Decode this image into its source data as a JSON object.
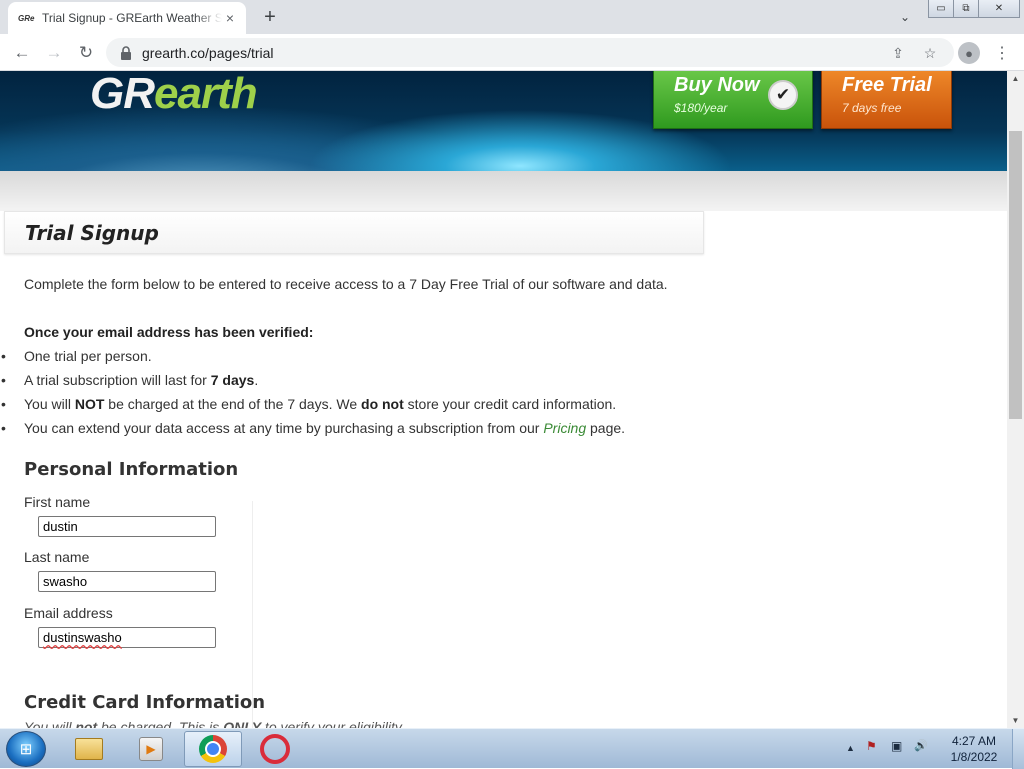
{
  "browser": {
    "tab": {
      "favicon": "GRe",
      "title": "Trial Signup - GREarth Weather S",
      "close": "×"
    },
    "new_tab": "+",
    "tab_search": "⌄",
    "window_controls": {
      "minimize": "▭",
      "restore": "⧉",
      "close": "✕"
    },
    "nav": {
      "back": "←",
      "forward": "→",
      "reload": "↻"
    },
    "url": "grearth.co/pages/trial",
    "icons": {
      "lock": "lock-icon",
      "share": "share-icon",
      "bookmark": "star-icon",
      "profile": "profile-icon",
      "menu": "kebab-menu-icon"
    }
  },
  "banner": {
    "logo": {
      "part1": "GR",
      "part2": "earth"
    },
    "buy": {
      "title": "Buy Now",
      "price": "$180/year",
      "check": "✔"
    },
    "trial": {
      "title": "Free Trial",
      "subtitle": "7 days free"
    }
  },
  "page": {
    "heading": "Trial Signup",
    "intro": "Complete the form below to be entered to receive access to a 7 Day Free Trial of our software and data.",
    "verify_heading": "Once your email address has been verified:",
    "bullets": {
      "b1": "One trial per person.",
      "b2_pre": "A trial subscription will last for ",
      "b2_bold": "7 days",
      "b2_post": ".",
      "b3_pre": "You will ",
      "b3_not": "NOT",
      "b3_mid": " be charged at the end of the 7 days. We ",
      "b3_donot": "do not",
      "b3_post": " store your credit card information.",
      "b4_pre": "You can extend your data access at any time by purchasing a subscription from our ",
      "b4_link": "Pricing",
      "b4_post": " page."
    },
    "personal": {
      "title": "Personal Information",
      "first_name_label": "First name",
      "first_name_value": "dustin",
      "last_name_label": "Last name",
      "last_name_value": "swasho",
      "email_label": "Email address",
      "email_value": "dustinswasho"
    },
    "credit": {
      "title": "Credit Card Information",
      "note_pre": "You will ",
      "note_not": "not",
      "note_mid": " be charged. This is ",
      "note_only": "ONLY",
      "note_post": " to verify your eligibility."
    }
  },
  "taskbar": {
    "start": "⊞",
    "apps": [
      "file-explorer-icon",
      "media-player-icon",
      "chrome-icon",
      "opera-icon"
    ],
    "tray": {
      "arrow": "▲",
      "flag": "⚑",
      "network": "▣",
      "volume": "🔊"
    },
    "time": "4:27 AM",
    "date": "1/8/2022"
  }
}
